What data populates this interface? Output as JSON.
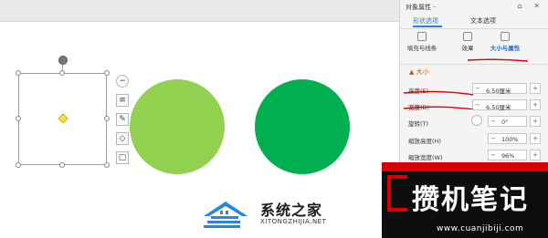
{
  "panel": {
    "title": "对象属性 -",
    "header_icons": "⌂ ✕",
    "tabs": [
      {
        "label": "形状选项"
      },
      {
        "label": "文本选项"
      }
    ],
    "subtabs": [
      {
        "label": "填充与线条"
      },
      {
        "label": "效果"
      },
      {
        "label": "大小与属性"
      }
    ],
    "section_title": "▲ 大小",
    "rows": [
      {
        "label": "高度(E)",
        "value": "6.50厘米"
      },
      {
        "label": "宽度(D)",
        "value": "6.50厘米"
      },
      {
        "label": "旋转(T)",
        "value": "0°"
      },
      {
        "label": "缩放高度(H)",
        "value": "100%"
      },
      {
        "label": "缩放宽度(W)",
        "value": "96%"
      }
    ]
  },
  "canvas": {
    "shapes": [
      {
        "name": "light-green-circle",
        "color": "#92d050"
      },
      {
        "name": "dark-green-circle",
        "color": "#00b050"
      }
    ],
    "mini_toolbar": [
      "−",
      "≡",
      "✎",
      "◇",
      "▢"
    ]
  },
  "watermark": {
    "title": "系统之家",
    "subtitle": "XITONGZHIJIA.NET"
  },
  "banner": {
    "title": "攒机笔记",
    "subtitle": "www.cuanjibiji.com"
  },
  "colors": {
    "accent": "#2c7ce0",
    "annotation": "#d90000"
  }
}
